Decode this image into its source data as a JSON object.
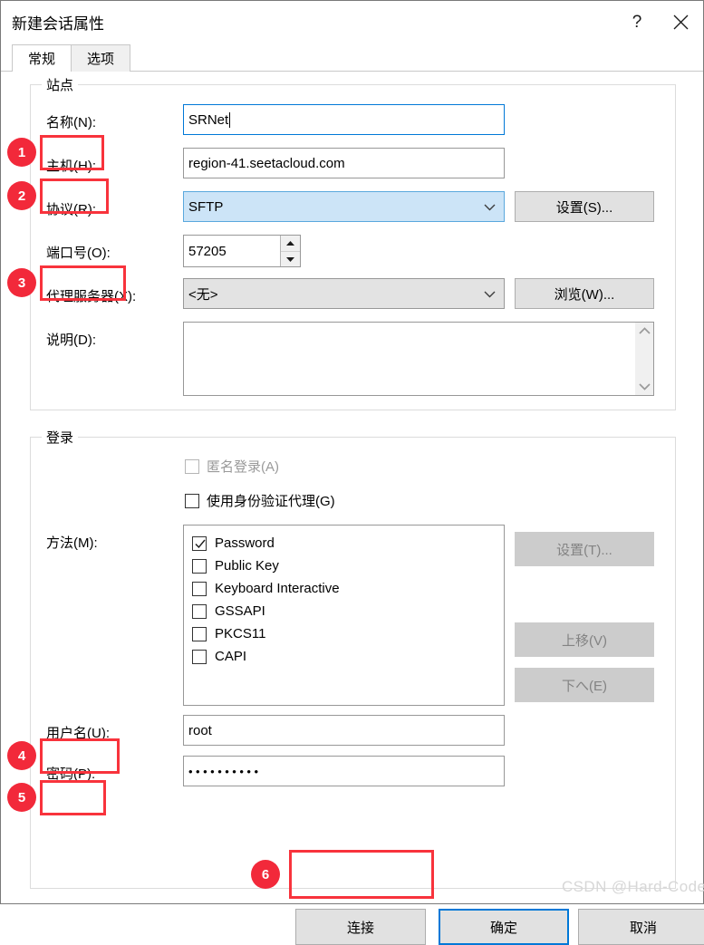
{
  "window": {
    "title": "新建会话属性",
    "help_icon": "question-mark-icon",
    "close_icon": "close-icon"
  },
  "tabs": [
    {
      "label": "常规",
      "active": true
    },
    {
      "label": "选项",
      "active": false
    }
  ],
  "site_group": {
    "legend": "站点",
    "fields": {
      "name_label": "名称(N):",
      "name_value": "SRNet",
      "host_label": "主机(H):",
      "host_value": "region-41.seetacloud.com",
      "protocol_label": "协议(R):",
      "protocol_value": "SFTP",
      "protocol_button": "设置(S)...",
      "port_label": "端口号(O):",
      "port_value": "57205",
      "proxy_label": "代理服务器(X):",
      "proxy_value": "<无>",
      "proxy_button": "浏览(W)...",
      "description_label": "说明(D):",
      "description_value": ""
    }
  },
  "login_group": {
    "legend": "登录",
    "anonymous_label": "匿名登录(A)",
    "auth_agent_label": "使用身份验证代理(G)",
    "method_label": "方法(M):",
    "methods": [
      {
        "label": "Password",
        "checked": true
      },
      {
        "label": "Public Key",
        "checked": false
      },
      {
        "label": "Keyboard Interactive",
        "checked": false
      },
      {
        "label": "GSSAPI",
        "checked": false
      },
      {
        "label": "PKCS11",
        "checked": false
      },
      {
        "label": "CAPI",
        "checked": false
      }
    ],
    "method_buttons": [
      {
        "label": "设置(T)...",
        "disabled": true
      },
      {
        "label": "上移(V)",
        "disabled": true
      },
      {
        "label": "下へ(E)",
        "disabled": true
      }
    ],
    "username_label": "用户名(U):",
    "username_value": "root",
    "password_label": "密码(P):",
    "password_value": "••••••••••"
  },
  "footer": {
    "connect_label": "连接",
    "ok_label": "确定",
    "cancel_label": "取消"
  },
  "annotations": {
    "badges": [
      "1",
      "2",
      "3",
      "4",
      "5",
      "6"
    ]
  },
  "watermark": "CSDN @Hard-Coder",
  "colors": {
    "accent": "#0078d7",
    "annotation_red": "#f8333c",
    "badge_red": "#f2293a",
    "combo_highlight": "#cce4f7",
    "button_face": "#e1e1e1",
    "disabled_face": "#cccccc"
  }
}
